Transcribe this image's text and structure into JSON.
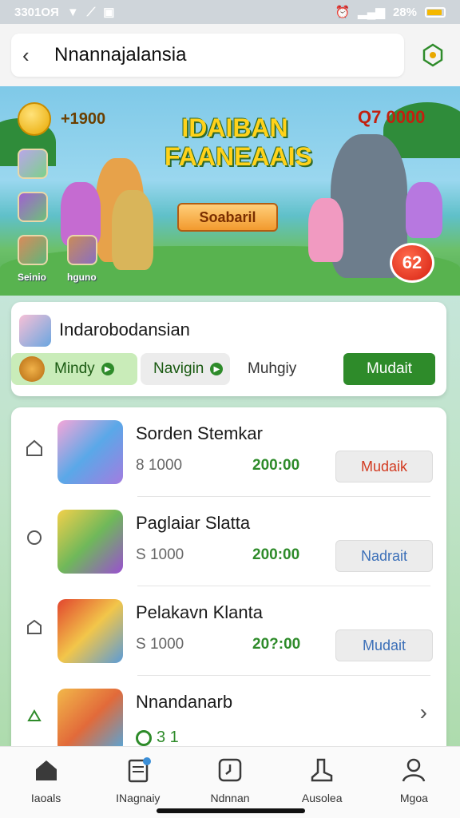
{
  "status_bar": {
    "time": "3301OЯ",
    "battery_percent": "28%"
  },
  "header": {
    "title": "Nnannajalansia"
  },
  "banner": {
    "coins": "+1900",
    "score": "Q7 0000",
    "title": "IDAIBAN FAANEAAIS",
    "button_label": "Soabaril",
    "level": "62",
    "thumb_labels": [
      "Seinio",
      "hguno"
    ]
  },
  "filter": {
    "title": "Indarobodansian",
    "chips": [
      "Mindy",
      "Navigin",
      "Muhgiy",
      "Mudait"
    ]
  },
  "list": {
    "items": [
      {
        "title": "Sorden Stemkar",
        "price": "8 1000",
        "amount": "200:00",
        "action": "Mudaik",
        "action_color": "#d2391f"
      },
      {
        "title": "Paglaiar Slatta",
        "price": "S 1000",
        "amount": "200:00",
        "action": "Nadrait",
        "action_color": "#3b6fb8"
      },
      {
        "title": "Pelakavn Klanta",
        "price": "S 1000",
        "amount": "20?:00",
        "action": "Mudait",
        "action_color": "#3b6fb8"
      },
      {
        "title": "Nnandanarb",
        "counter": "3 1"
      }
    ]
  },
  "bottom_nav": [
    {
      "label": "Iaoals",
      "icon": "home-icon"
    },
    {
      "label": "INagnaiy",
      "icon": "document-icon"
    },
    {
      "label": "Ndnnan",
      "icon": "clock-icon"
    },
    {
      "label": "Ausolea",
      "icon": "boot-icon"
    },
    {
      "label": "Mgoa",
      "icon": "user-icon"
    }
  ]
}
